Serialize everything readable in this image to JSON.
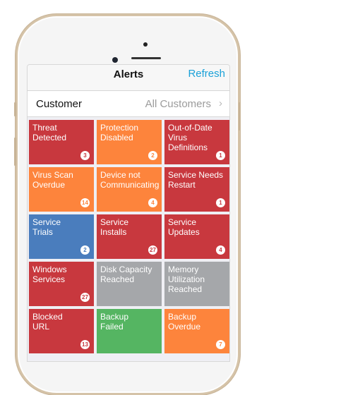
{
  "navbar": {
    "title": "Alerts",
    "refresh_label": "Refresh"
  },
  "filter": {
    "label": "Customer",
    "value": "All Customers",
    "chevron": "›"
  },
  "colors": {
    "red": "#c8383e",
    "orange": "#fd843c",
    "blue": "#4a7dbd",
    "gray": "#a5a7aa",
    "green": "#55b562",
    "accent": "#1aa1d8"
  },
  "tiles": [
    {
      "label": "Threat\nDetected",
      "count": "3",
      "color": "#c8383e"
    },
    {
      "label": "Protection\nDisabled",
      "count": "2",
      "color": "#fd843c"
    },
    {
      "label": "Out-of-Date\nVirus\nDefinitions",
      "count": "1",
      "color": "#c8383e"
    },
    {
      "label": "Virus Scan\nOverdue",
      "count": "14",
      "color": "#fd843c"
    },
    {
      "label": "Device not\nCommunicating",
      "count": "4",
      "color": "#fd843c"
    },
    {
      "label": "Service Needs\nRestart",
      "count": "1",
      "color": "#c8383e"
    },
    {
      "label": "Service\nTrials",
      "count": "2",
      "color": "#4a7dbd"
    },
    {
      "label": "Service\nInstalls",
      "count": "27",
      "color": "#c8383e"
    },
    {
      "label": "Service\nUpdates",
      "count": "4",
      "color": "#c8383e"
    },
    {
      "label": "Windows\nServices",
      "count": "27",
      "color": "#c8383e"
    },
    {
      "label": "Disk Capacity\nReached",
      "count": null,
      "color": "#a5a7aa"
    },
    {
      "label": "Memory\nUtilization\nReached",
      "count": null,
      "color": "#a5a7aa"
    },
    {
      "label": "Blocked\nURL",
      "count": "13",
      "color": "#c8383e"
    },
    {
      "label": "Backup\nFailed",
      "count": null,
      "color": "#55b562"
    },
    {
      "label": "Backup\nOverdue",
      "count": "7",
      "color": "#fd843c"
    }
  ]
}
